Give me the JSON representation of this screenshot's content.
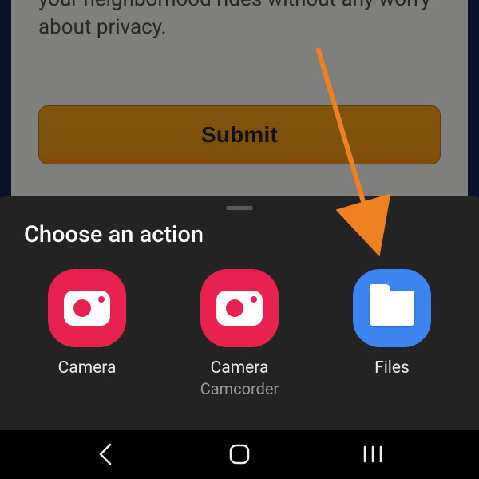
{
  "page": {
    "body_text": "your neighborhood rides without any worry about privacy.",
    "submit_label": "Submit"
  },
  "sheet": {
    "title": "Choose an action",
    "apps": [
      {
        "name": "camera",
        "label": "Camera",
        "sub": "",
        "icon": "camera-icon",
        "color": "pink"
      },
      {
        "name": "camera-camcorder",
        "label": "Camera",
        "sub": "Camcorder",
        "icon": "camera-icon",
        "color": "pink"
      },
      {
        "name": "files",
        "label": "Files",
        "sub": "",
        "icon": "folder-icon",
        "color": "blue"
      }
    ]
  },
  "annotation": {
    "arrow_color": "#ef8220",
    "points_to": "files"
  }
}
